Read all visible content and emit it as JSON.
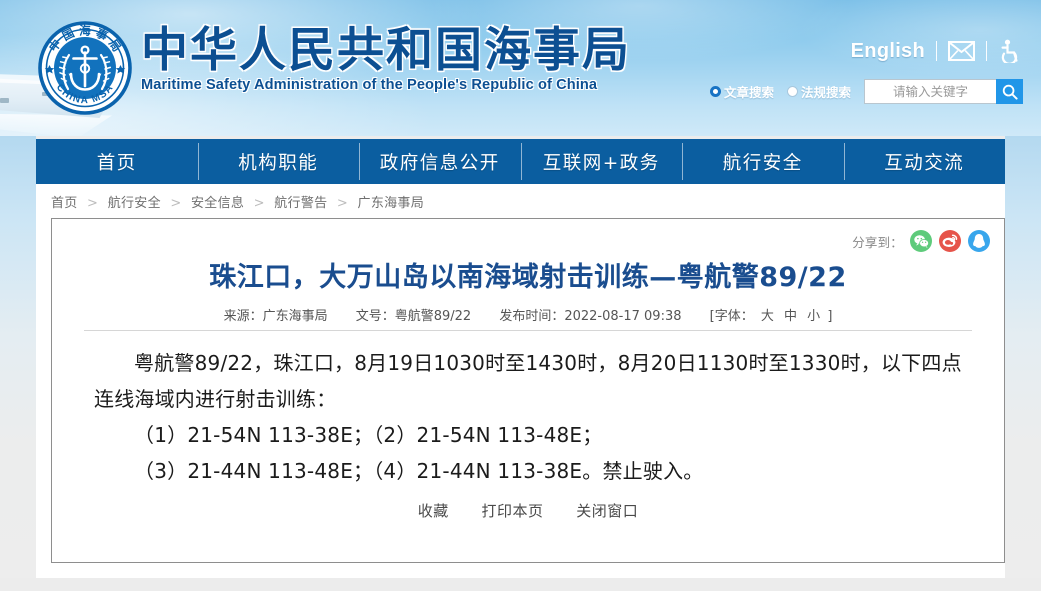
{
  "site": {
    "logo_alt": "china-msa-emblem",
    "emblem_top_text": "中国海事局",
    "emblem_bottom_text": "CHINA MSA",
    "title_cn": "中华人民共和国海事局",
    "title_en": "Maritime Safety Administration of the People's Republic of China",
    "brand_color": "#0c4f92",
    "nav_color": "#0b5ea0"
  },
  "topbar": {
    "english_label": "English",
    "mail_icon": "envelope-icon",
    "accessibility_icon": "accessibility-icon"
  },
  "search": {
    "options": [
      {
        "label": "文章搜索",
        "selected": true
      },
      {
        "label": "法规搜索",
        "selected": false
      }
    ],
    "placeholder": "请输入关键字",
    "value": "",
    "button_icon": "magnifier-icon"
  },
  "nav": {
    "items": [
      {
        "label": "首页"
      },
      {
        "label": "机构职能"
      },
      {
        "label": "政府信息公开"
      },
      {
        "label": "互联网+政务"
      },
      {
        "label": "航行安全"
      },
      {
        "label": "互动交流"
      }
    ]
  },
  "breadcrumb": {
    "separator": ">",
    "items": [
      {
        "label": "首页"
      },
      {
        "label": "航行安全"
      },
      {
        "label": "安全信息"
      },
      {
        "label": "航行警告"
      },
      {
        "label": "广东海事局"
      }
    ]
  },
  "share": {
    "label": "分享到：",
    "targets": [
      {
        "name": "wechat",
        "icon": "wechat-icon",
        "color": "#5ecb7b"
      },
      {
        "name": "weibo",
        "icon": "weibo-icon",
        "color": "#e6544a"
      },
      {
        "name": "qq",
        "icon": "qq-icon",
        "color": "#38a6ec"
      }
    ]
  },
  "article": {
    "title": "珠江口，大万山岛以南海域射击训练—粤航警89/22",
    "meta": {
      "source": "来源：广东海事局",
      "doc_no": "文号：粤航警89/22",
      "publish_time": "发布时间：2022-08-17 09:38",
      "font_prefix": "[字体：",
      "font_large": "大",
      "font_medium": "中",
      "font_small": "小",
      "font_suffix": "]"
    },
    "paragraphs": [
      "粤航警89/22，珠江口，8月19日1030时至1430时，8月20日1130时至1330时，以下四点连线海域内进行射击训练：",
      "（1）21-54N 113-38E；（2）21-54N 113-48E；",
      "（3）21-44N 113-48E；（4）21-44N 113-38E。禁止驶入。"
    ]
  },
  "actions": {
    "favorite": "收藏",
    "print": "打印本页",
    "close": "关闭窗口"
  }
}
